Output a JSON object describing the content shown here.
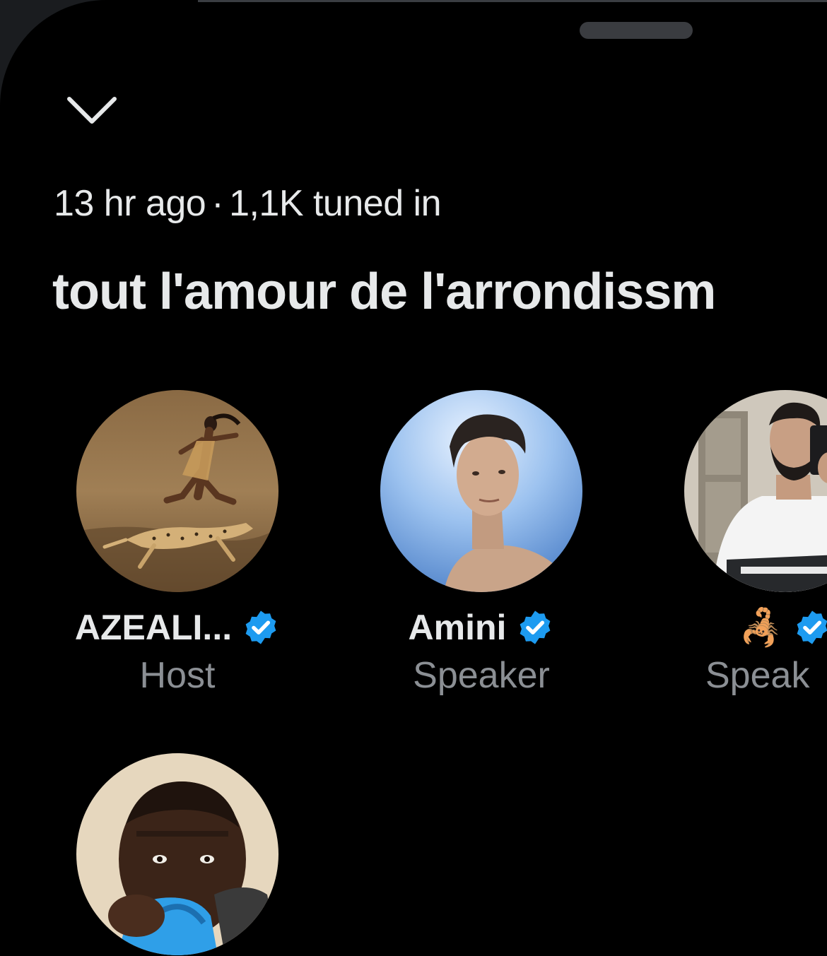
{
  "space": {
    "time_ago": "13 hr ago",
    "separator": "·",
    "tuned_in": "1,1K tuned in",
    "title": "tout l'amour de l'arrondissm"
  },
  "participants": [
    {
      "name": "AZEALI...",
      "role": "Host",
      "verified": true,
      "avatar": "runner-with-cheetah-photo"
    },
    {
      "name": "Amini",
      "role": "Speaker",
      "verified": true,
      "avatar": "man-blue-sky-photo"
    },
    {
      "name": "🦂",
      "role": "Speak",
      "verified": true,
      "avatar": "mirror-selfie-photo"
    },
    {
      "name": "",
      "role": "",
      "verified": false,
      "avatar": "man-covering-face-photo"
    }
  ],
  "icons": {
    "collapse": "chevron-down-icon",
    "verified": "verified-badge-icon"
  },
  "colors": {
    "background": "#000000",
    "text": "#e7e9ea",
    "secondary_text": "#8b8f94",
    "verified_blue": "#1d9bf0"
  }
}
